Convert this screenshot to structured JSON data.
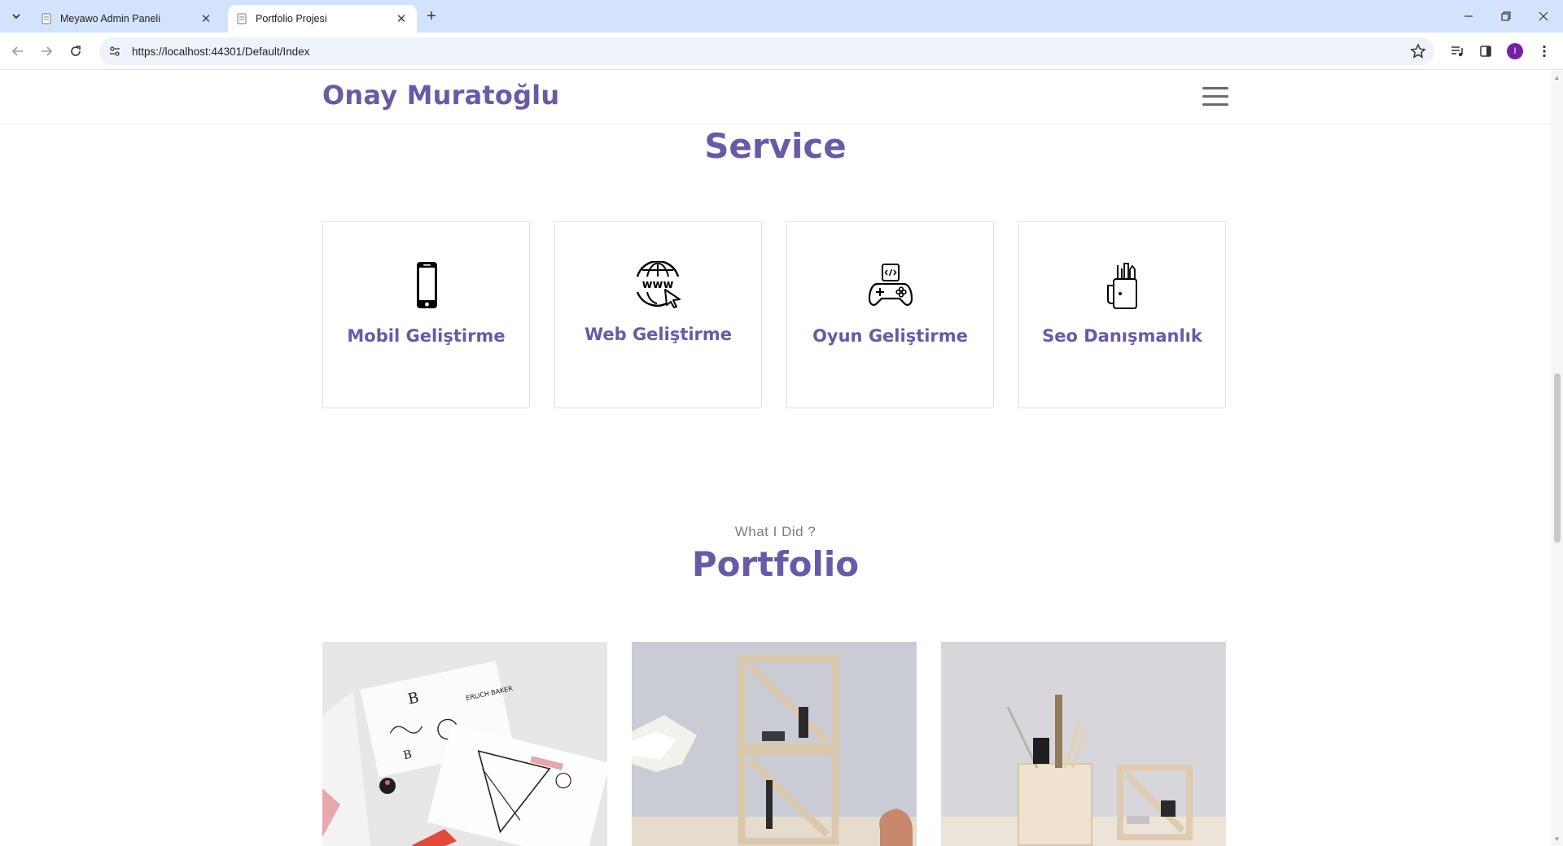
{
  "browser": {
    "tabs": [
      {
        "title": "Meyawo Admin Paneli",
        "active": false
      },
      {
        "title": "Portfolio Projesi",
        "active": true
      }
    ],
    "url": "https://localhost:44301/Default/Index",
    "profile_initial": "I",
    "colors": {
      "tabbar": "#d3e3fd",
      "profile": "#7a1fa2"
    }
  },
  "site": {
    "brand": "Onay Muratoğlu",
    "accent_color": "#695aa6"
  },
  "services": {
    "title": "Service",
    "items": [
      {
        "label": "Mobil Geliştirme",
        "icon": "mobile-phone-icon"
      },
      {
        "label": "Web Geliştirme",
        "icon": "www-globe-icon"
      },
      {
        "label": "Oyun Geliştirme",
        "icon": "game-controller-icon"
      },
      {
        "label": "Seo Danışmanlık",
        "icon": "pen-holder-icon"
      }
    ]
  },
  "portfolio": {
    "subtitle": "What I Did ?",
    "title": "Portfolio",
    "items": [
      {
        "image": "sketch-papers-photo"
      },
      {
        "image": "wooden-shelf-lamp-photo"
      },
      {
        "image": "wooden-box-desk-photo"
      }
    ]
  }
}
